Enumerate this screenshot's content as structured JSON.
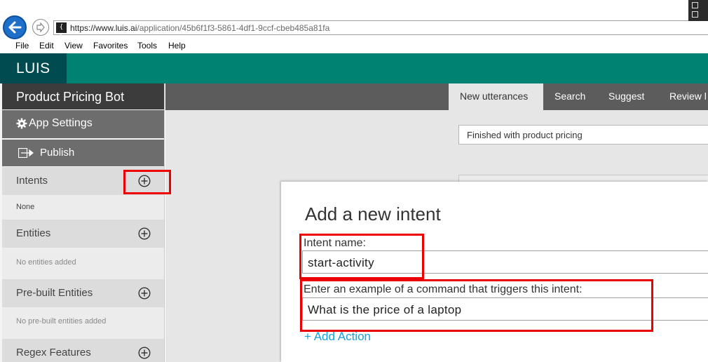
{
  "browser": {
    "url_prefix": "https://www.",
    "url_domain": "luis.ai",
    "url_path": "/application/45b6f1f3-5861-4df1-9ccf-cbeb485a81fa",
    "site_icon_glyph": "{ }",
    "menu": [
      "File",
      "Edit",
      "View",
      "Favorites",
      "Tools",
      "Help"
    ]
  },
  "app": {
    "logo": "LUIS",
    "app_name": "Product Pricing Bot",
    "settings_label": "App Settings",
    "publish_label": "Publish"
  },
  "sidebar": {
    "sections": [
      {
        "label": "Intents",
        "items": [
          "None"
        ]
      },
      {
        "label": "Entities",
        "empty_text": "No entities added"
      },
      {
        "label": "Pre-built Entities",
        "empty_text": "No pre-built entities added"
      },
      {
        "label": "Regex Features"
      }
    ]
  },
  "tabs": [
    "New utterances",
    "Search",
    "Suggest",
    "Review l"
  ],
  "utterance_input": {
    "value": "Finished with product pricing"
  },
  "dialog": {
    "title": "Add a new intent",
    "intent_name_label": "Intent name:",
    "intent_name_value": "start-activity",
    "example_label": "Enter an example of a command that triggers this intent:",
    "example_value": "What is the price of a laptop",
    "add_action_label": "+ Add Action"
  },
  "colors": {
    "header_teal": "#008272",
    "logo_bg": "#004b50",
    "highlight_red": "#ee0000",
    "link_blue": "#1aa0d8"
  },
  "icons": [
    "back-arrow-icon",
    "forward-arrow-icon",
    "gear-icon",
    "publish-icon",
    "plus-circle-icon"
  ]
}
